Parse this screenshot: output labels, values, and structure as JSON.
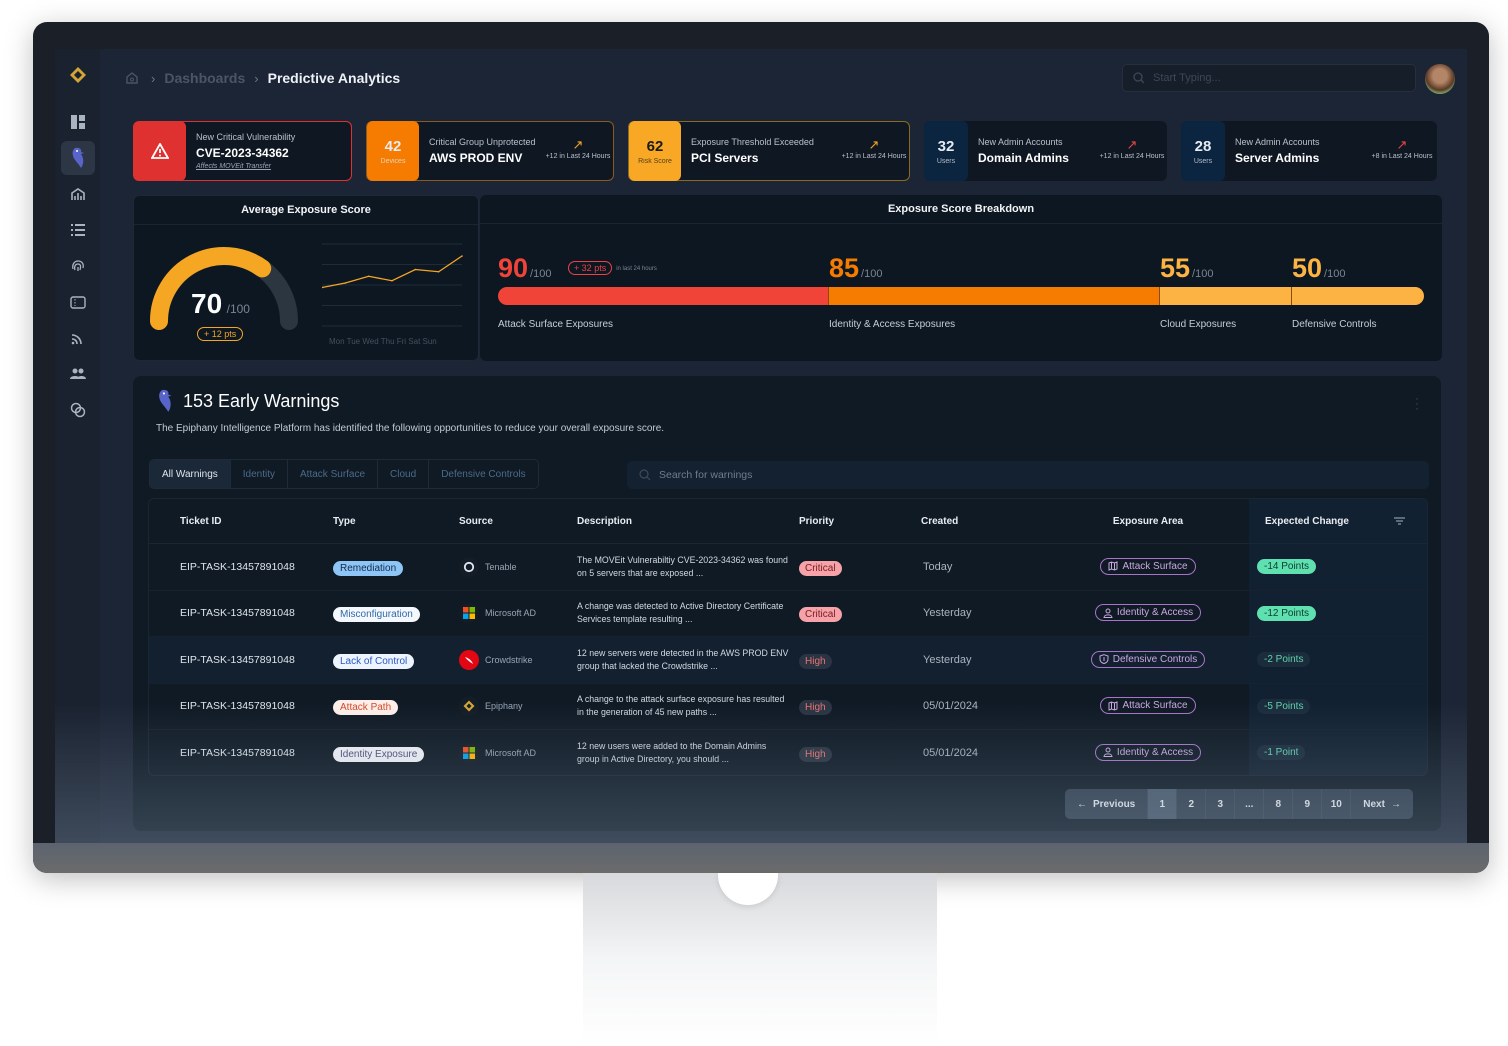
{
  "breadcrumb": {
    "items": [
      "Dashboards",
      "Predictive Analytics"
    ]
  },
  "search_top": {
    "placeholder": "Start Typing..."
  },
  "alerts": [
    {
      "badge_icon": "warning-icon",
      "sub": "New Critical Vulnerability",
      "main": "CVE-2023-34362",
      "link": "Affects MOVEit Transfer",
      "color": "#e03131"
    },
    {
      "num": "42",
      "unit": "Devices",
      "sub": "Critical Group Unprotected",
      "main": "AWS PROD ENV",
      "trend": "+12 in Last 24 Hours",
      "color": "#f57c00"
    },
    {
      "num": "62",
      "unit": "Risk Score",
      "sub": "Exposure Threshold Exceeded",
      "main": "PCI Servers",
      "trend": "+12 in Last 24 Hours",
      "color": "#f9a825"
    },
    {
      "num": "32",
      "unit": "Users",
      "sub": "New Admin Accounts",
      "main": "Domain Admins",
      "trend": "+12 in Last 24 Hours",
      "color": "#0b2440"
    },
    {
      "num": "28",
      "unit": "Users",
      "sub": "New Admin Accounts",
      "main": "Server Admins",
      "trend": "+8 in Last 24 Hours",
      "color": "#0b2440"
    }
  ],
  "avg_exposure": {
    "title": "Average Exposure Score",
    "score": "70",
    "of": "/100",
    "score_value": 70,
    "delta": "+ 12 pts",
    "days": "Mon Tue Wed Thu Fri Sat Sun"
  },
  "chart_data": {
    "type": "line",
    "title": "Average Exposure Score trend",
    "categories": [
      "Mon",
      "Tue",
      "Wed",
      "Thu",
      "Fri",
      "Sat",
      "Sun"
    ],
    "values": [
      58,
      60,
      63,
      61,
      66,
      65,
      72
    ],
    "ylim": [
      0,
      100
    ],
    "grid": true
  },
  "breakdown": {
    "title": "Exposure Score Breakdown",
    "delta": "+ 32 pts",
    "delta_note": "in last 24 hours",
    "items": [
      {
        "score": "90",
        "value": 90,
        "of": "/100",
        "label": "Attack Surface Exposures",
        "color": "#f04438"
      },
      {
        "score": "85",
        "value": 85,
        "of": "/100",
        "label": "Identity & Access Exposures",
        "color": "#f57c00"
      },
      {
        "score": "55",
        "value": 55,
        "of": "/100",
        "label": "Cloud Exposures",
        "color": "#fdb344"
      },
      {
        "score": "50",
        "value": 50,
        "of": "/100",
        "label": "Defensive Controls",
        "color": "#fdb344"
      }
    ]
  },
  "warnings": {
    "title": "153 Early Warnings",
    "description": "The Epiphany Intelligence Platform has identified the following opportunities to reduce your overall exposure score.",
    "tabs": [
      "All Warnings",
      "Identity",
      "Attack Surface",
      "Cloud",
      "Defensive Controls"
    ],
    "search_placeholder": "Search for warnings",
    "columns": [
      "Ticket ID",
      "Type",
      "Source",
      "Description",
      "Priority",
      "Created",
      "Exposure Area",
      "Expected Change"
    ],
    "rows": [
      {
        "id": "EIP-TASK-13457891048",
        "type": "Remediation",
        "source": "Tenable",
        "desc": "The MOVEit Vulnerabiltiy CVE-2023-34362 was found on 5 servers that are exposed ...",
        "priority": "Critical",
        "created": "Today",
        "area": "Attack Surface",
        "change": "-14 Points"
      },
      {
        "id": "EIP-TASK-13457891048",
        "type": "Misconfiguration",
        "source": "Microsoft AD",
        "desc": "A change was detected to Active Directory Certificate Services template resulting ...",
        "priority": "Critical",
        "created": "Yesterday",
        "area": "Identity & Access",
        "change": "-12 Points"
      },
      {
        "id": "EIP-TASK-13457891048",
        "type": "Lack of Control",
        "source": "Crowdstrike",
        "desc": "12 new servers were detected in the AWS PROD ENV group that lacked the Crowdstrike ...",
        "priority": "High",
        "created": "Yesterday",
        "area": "Defensive Controls",
        "change": "-2 Points"
      },
      {
        "id": "EIP-TASK-13457891048",
        "type": "Attack Path",
        "source": "Epiphany",
        "desc": "A change to the attack surface exposure has resulted in the generation of 45 new paths ...",
        "priority": "High",
        "created": "05/01/2024",
        "area": "Attack Surface",
        "change": "-5 Points"
      },
      {
        "id": "EIP-TASK-13457891048",
        "type": "Identity Exposure",
        "source": "Microsoft AD",
        "desc": "12 new users were added to the Domain Admins group in Active Directory, you should ...",
        "priority": "High",
        "created": "05/01/2024",
        "area": "Identity & Access",
        "change": "-1 Point"
      }
    ]
  },
  "pagination": {
    "previous": "Previous",
    "next": "Next",
    "pages": [
      "1",
      "2",
      "3",
      "...",
      "8",
      "9",
      "10"
    ],
    "current": "1"
  }
}
